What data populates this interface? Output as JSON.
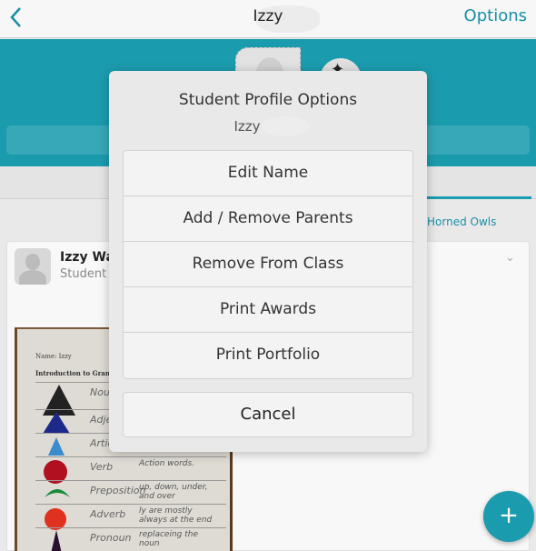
{
  "navbar": {
    "title": "Izzy",
    "options_label": "Options",
    "back_icon": "chevron-left-icon"
  },
  "colors": {
    "accent": "#1b9cae",
    "link": "#1a8fa6"
  },
  "profile": {
    "class_tab_label": "Horned Owls"
  },
  "story_card": {
    "name": "Izzy Wai",
    "subtitle": "Student o",
    "worksheet": {
      "name_label": "Name: Izzy",
      "title": "Introduction to Grammar",
      "rows": [
        {
          "word": "Noun",
          "desc": ""
        },
        {
          "word": "Adjective",
          "desc": ""
        },
        {
          "word": "Article",
          "desc": ""
        },
        {
          "word": "Verb",
          "desc": "Action words."
        },
        {
          "word": "Preposition",
          "desc": "up, down, under, and over"
        },
        {
          "word": "Adverb",
          "desc": "ly are mostly always at the end"
        },
        {
          "word": "Pronoun",
          "desc": "replaceing the noun"
        }
      ]
    }
  },
  "fab": {
    "label": "+"
  },
  "dialog": {
    "title": "Student Profile Options",
    "subtitle": "Izzy",
    "options": [
      {
        "label": "Edit Name"
      },
      {
        "label": "Add / Remove Parents"
      },
      {
        "label": "Remove From Class"
      },
      {
        "label": "Print Awards"
      },
      {
        "label": "Print Portfolio"
      }
    ],
    "cancel_label": "Cancel"
  }
}
